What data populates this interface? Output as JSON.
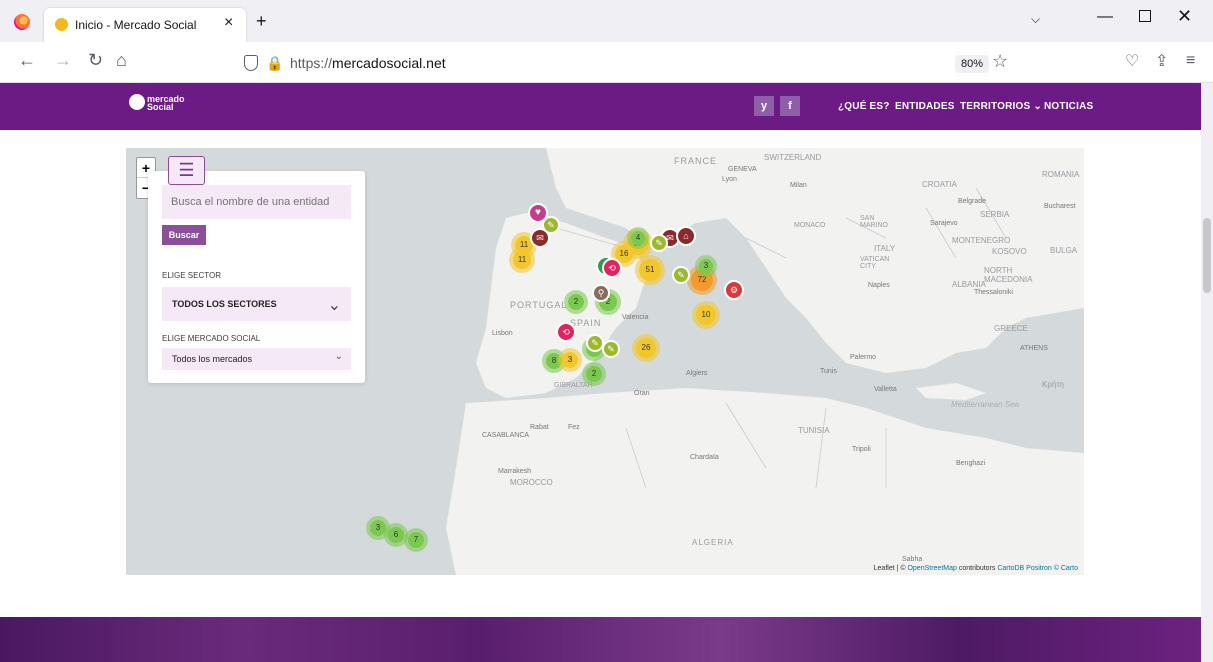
{
  "browser": {
    "tab_title": "Inicio - Mercado Social",
    "url_prefix": "https://",
    "url_host": "mercadosocial.net",
    "zoom": "80%"
  },
  "site": {
    "logo_line1": "mercado",
    "logo_line2": "Social",
    "social": [
      "y",
      "f"
    ],
    "nav": [
      "¿QUÉ ES?",
      "ENTIDADES",
      "TERRITORIOS ⌄",
      "NOTICIAS"
    ]
  },
  "panel": {
    "search_placeholder": "Busca el nombre de una entidad",
    "search_button": "Buscar",
    "sector_label": "ELIGE SECTOR",
    "sector_value": "TODOS LOS SECTORES",
    "market_label": "ELIGE MERCADO SOCIAL",
    "market_value": "Todos los mercados"
  },
  "map": {
    "zoom_in": "+",
    "zoom_out": "−",
    "place_labels": [
      "FRANCE",
      "GENEVA",
      "Lyon",
      "SWITZERLAND",
      "Milan",
      "MONACO",
      "SAN MARINO",
      "ITALY",
      "VATICAN CITY",
      "Naples",
      "CROATIA",
      "Belgrade",
      "SERBIA",
      "Sarajevo",
      "MONTENEGRO",
      "KOSOVO",
      "NORTH MACEDONIA",
      "ALBANIA",
      "Thessaloniki",
      "GREECE",
      "ATHENS",
      "ROMANIA",
      "Bucharest",
      "BULGA",
      "PORTUGAL",
      "SPAIN",
      "Valencia",
      "Lisbon",
      "GIBRALTAR",
      "Oran",
      "Algiers",
      "Tunis",
      "Valletta",
      "Palermo",
      "Mediterranean Sea",
      "Rabat",
      "Fez",
      "CASABLANCA",
      "TUNISIA",
      "Tripoli",
      "Benghazi",
      "Chardaïa",
      "Marrakesh",
      "MOROCCO",
      "ALGERIA",
      "Sabha",
      "Κρήτη"
    ],
    "clusters": [
      {
        "label": "11",
        "color": "#f2c72c"
      },
      {
        "label": "11",
        "color": "#f2c72c"
      },
      {
        "label": "37",
        "color": "#f2c72c"
      },
      {
        "label": "16",
        "color": "#f2c72c"
      },
      {
        "label": "51",
        "color": "#f2c72c"
      },
      {
        "label": "72",
        "color": "#f29a2c"
      },
      {
        "label": "2",
        "color": "#7ac84e"
      },
      {
        "label": "2",
        "color": "#7ac84e"
      },
      {
        "label": "10",
        "color": "#f2c72c"
      },
      {
        "label": "8",
        "color": "#7ac84e"
      },
      {
        "label": "3",
        "color": "#f2c72c"
      },
      {
        "label": "4",
        "color": "#7ac84e"
      },
      {
        "label": "26",
        "color": "#f2c72c"
      },
      {
        "label": "2",
        "color": "#7ac84e"
      },
      {
        "label": "3",
        "color": "#7ac84e"
      },
      {
        "label": "6",
        "color": "#7ac84e"
      },
      {
        "label": "7",
        "color": "#7ac84e"
      },
      {
        "label": "4",
        "color": "#7ac84e"
      },
      {
        "label": "3",
        "color": "#7ac84e"
      }
    ],
    "attribution": {
      "prefix": "Leaflet | © ",
      "osm": "OpenStreetMap",
      "middle": " contributors ",
      "carto": "CartoDB Positron © Carto"
    }
  }
}
